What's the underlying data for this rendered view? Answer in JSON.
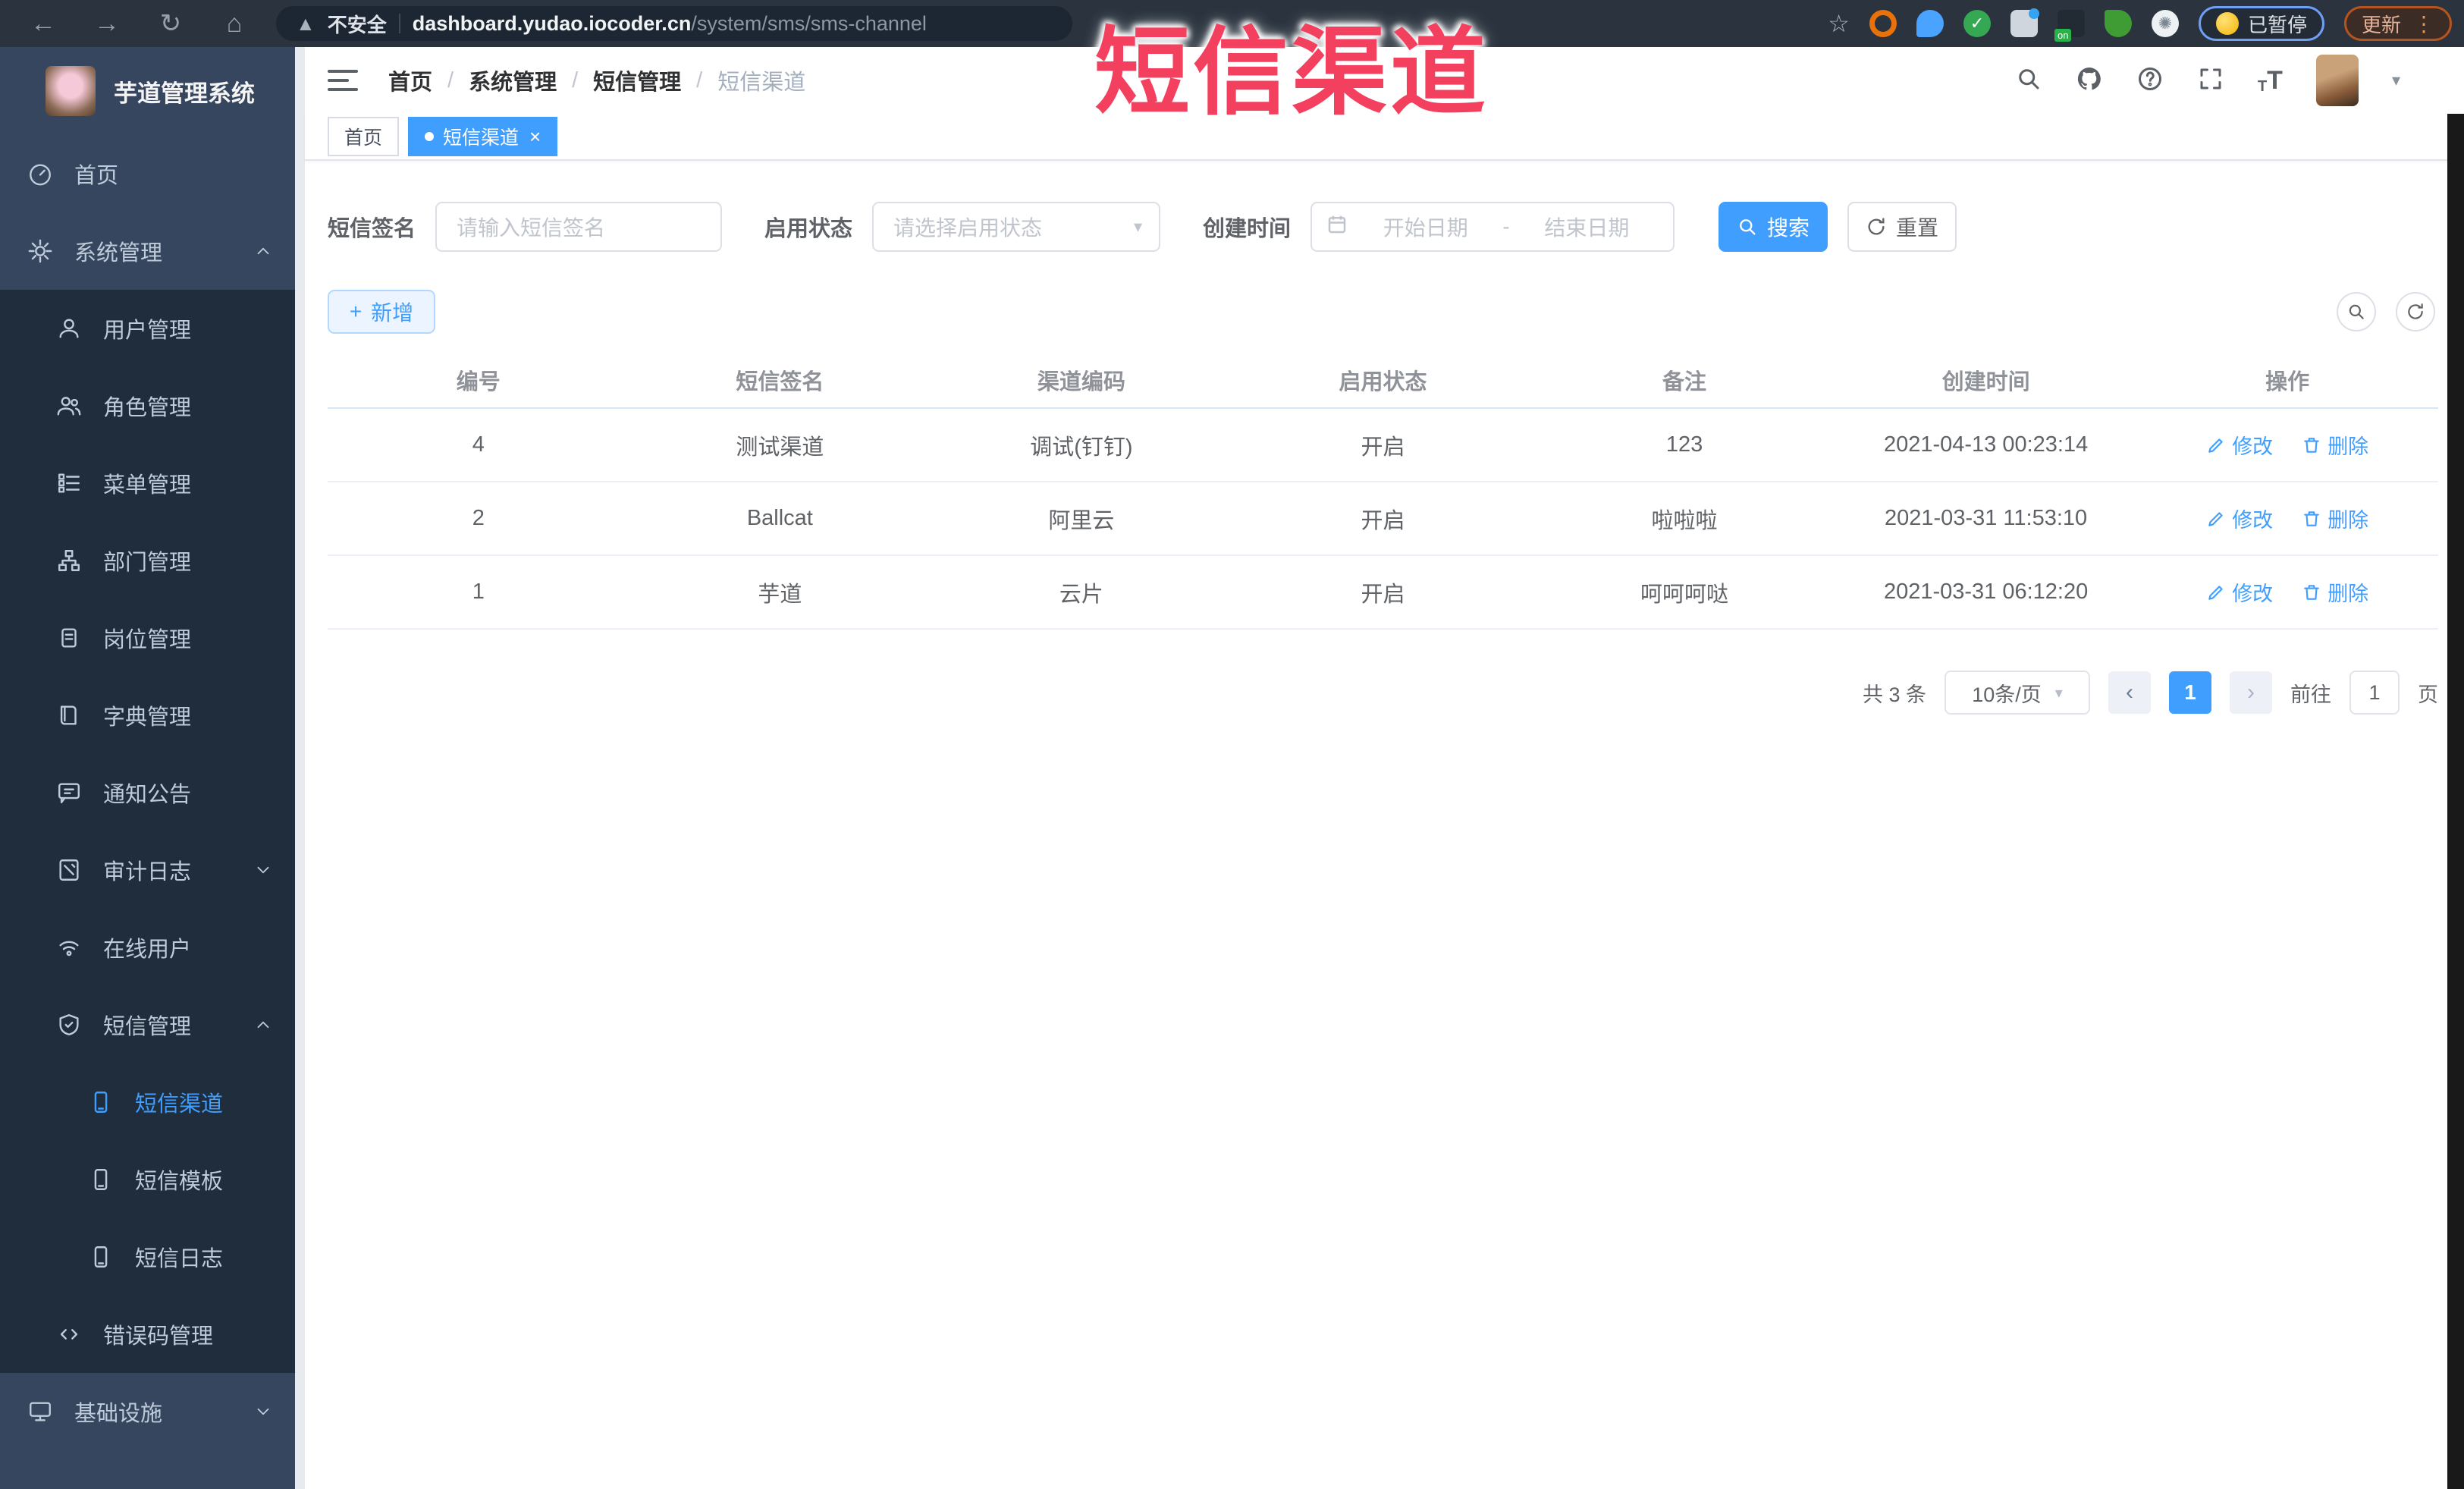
{
  "browser": {
    "security_label": "不安全",
    "url_host": "dashboard.yudao.iocoder.cn",
    "url_path": "/system/sms/sms-channel",
    "paused_badge": "已暂停",
    "update_badge": "更新"
  },
  "watermark_text": "短信渠道",
  "sidebar": {
    "app_title": "芋道管理系统",
    "items": [
      {
        "label": "首页"
      },
      {
        "label": "系统管理"
      },
      {
        "label": "用户管理"
      },
      {
        "label": "角色管理"
      },
      {
        "label": "菜单管理"
      },
      {
        "label": "部门管理"
      },
      {
        "label": "岗位管理"
      },
      {
        "label": "字典管理"
      },
      {
        "label": "通知公告"
      },
      {
        "label": "审计日志"
      },
      {
        "label": "在线用户"
      },
      {
        "label": "短信管理"
      },
      {
        "label": "短信渠道"
      },
      {
        "label": "短信模板"
      },
      {
        "label": "短信日志"
      },
      {
        "label": "错误码管理"
      },
      {
        "label": "基础设施"
      }
    ]
  },
  "breadcrumb": {
    "items": [
      "首页",
      "系统管理",
      "短信管理",
      "短信渠道"
    ]
  },
  "tabs": {
    "home": "首页",
    "active": "短信渠道"
  },
  "filters": {
    "sign_label": "短信签名",
    "sign_placeholder": "请输入短信签名",
    "status_label": "启用状态",
    "status_placeholder": "请选择启用状态",
    "date_label": "创建时间",
    "date_start_placeholder": "开始日期",
    "date_separator": "-",
    "date_end_placeholder": "结束日期",
    "search_label": "搜索",
    "reset_label": "重置"
  },
  "toolbar": {
    "add_label": "新增"
  },
  "table": {
    "columns": [
      "编号",
      "短信签名",
      "渠道编码",
      "启用状态",
      "备注",
      "创建时间",
      "操作"
    ],
    "edit_label": "修改",
    "delete_label": "删除",
    "rows": [
      {
        "id": "4",
        "sign": "测试渠道",
        "code": "调试(钉钉)",
        "status": "开启",
        "remark": "123",
        "created": "2021-04-13 00:23:14"
      },
      {
        "id": "2",
        "sign": "Ballcat",
        "code": "阿里云",
        "status": "开启",
        "remark": "啦啦啦",
        "created": "2021-03-31 11:53:10"
      },
      {
        "id": "1",
        "sign": "芋道",
        "code": "云片",
        "status": "开启",
        "remark": "呵呵呵哒",
        "created": "2021-03-31 06:12:20"
      }
    ]
  },
  "pagination": {
    "total_label": "共 3 条",
    "page_size": "10条/页",
    "current_page": "1",
    "goto_label": "前往",
    "goto_value": "1",
    "page_unit": "页"
  },
  "colors": {
    "primary": "#409eff",
    "watermark": "#f43f5e",
    "sidebar_bg": "#36465f",
    "submenu_bg": "#1f2d3d"
  }
}
